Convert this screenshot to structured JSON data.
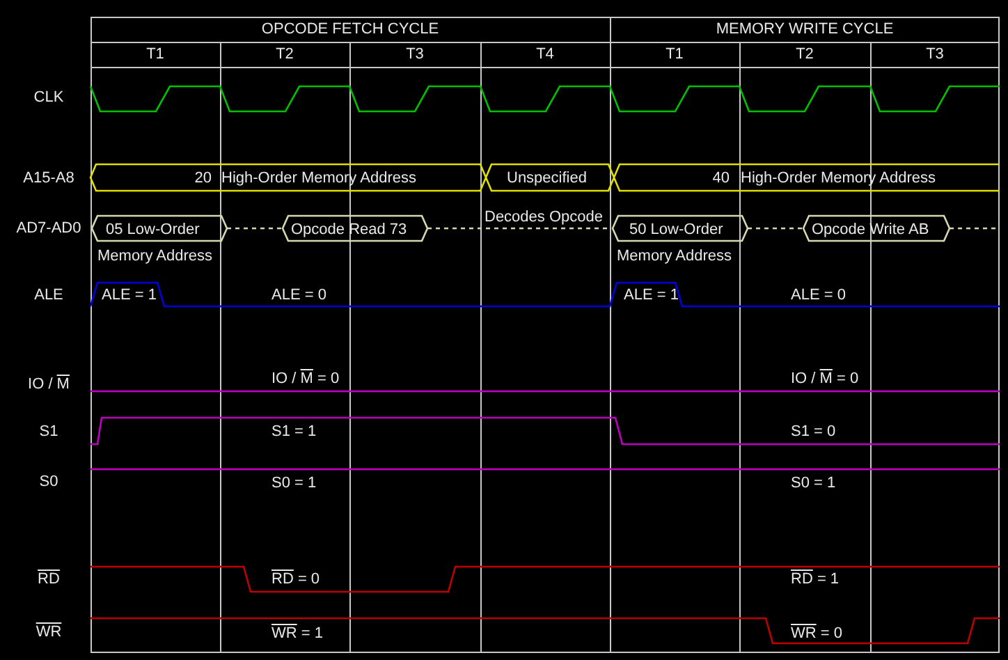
{
  "cycles": [
    {
      "title": "OPCODE FETCH CYCLE",
      "states": [
        "T1",
        "T2",
        "T3",
        "T4"
      ]
    },
    {
      "title": "MEMORY WRITE CYCLE",
      "states": [
        "T1",
        "T2",
        "T3"
      ]
    }
  ],
  "signals": [
    {
      "kind": "clock",
      "color": "#00c000",
      "name": [
        {
          "text": "CLK",
          "overline": false
        }
      ]
    },
    {
      "kind": "bus",
      "color": "#e0e000",
      "name": [
        {
          "text": "A15-A8",
          "overline": false
        }
      ],
      "annotations": [
        [
          {
            "text": "20",
            "overline": false
          }
        ],
        [
          {
            "text": "High-Order Memory Address",
            "overline": false
          }
        ],
        [
          {
            "text": "Unspecified",
            "overline": false
          }
        ],
        [
          {
            "text": "40",
            "overline": false
          }
        ],
        [
          {
            "text": "High-Order Memory Address",
            "overline": false
          }
        ]
      ]
    },
    {
      "kind": "bus",
      "color": "#d8d8b0",
      "name": [
        {
          "text": "AD7-AD0",
          "overline": false
        }
      ],
      "annotations": [
        [
          {
            "text": "05 Low-Order",
            "overline": false
          }
        ],
        [
          {
            "text": "Memory Address",
            "overline": false
          }
        ],
        [
          {
            "text": "Opcode Read 73",
            "overline": false
          }
        ],
        [
          {
            "text": "Decodes Opcode",
            "overline": false
          }
        ],
        [
          {
            "text": "50 Low-Order",
            "overline": false
          }
        ],
        [
          {
            "text": "Memory Address",
            "overline": false
          }
        ],
        [
          {
            "text": "Opcode Write AB",
            "overline": false
          }
        ]
      ]
    },
    {
      "kind": "line",
      "color": "#0000e0",
      "name": [
        {
          "text": "ALE",
          "overline": false
        }
      ],
      "annotations": [
        [
          {
            "text": "ALE = 1",
            "overline": false
          }
        ],
        [
          {
            "text": "ALE = 0",
            "overline": false
          }
        ],
        [
          {
            "text": "ALE = 1",
            "overline": false
          }
        ],
        [
          {
            "text": "ALE = 0",
            "overline": false
          }
        ]
      ]
    },
    {
      "kind": "line",
      "color": "#c000c0",
      "name": [
        {
          "text": "IO / ",
          "overline": false
        },
        {
          "text": "M",
          "overline": true
        }
      ],
      "annotations": [
        [
          {
            "text": "IO / ",
            "overline": false
          },
          {
            "text": "M",
            "overline": true
          },
          {
            "text": " = 0",
            "overline": false
          }
        ],
        [
          {
            "text": "IO / ",
            "overline": false
          },
          {
            "text": "M",
            "overline": true
          },
          {
            "text": " = 0",
            "overline": false
          }
        ]
      ]
    },
    {
      "kind": "line",
      "color": "#c000c0",
      "name": [
        {
          "text": "S1",
          "overline": false
        }
      ],
      "annotations": [
        [
          {
            "text": "S1 = 1",
            "overline": false
          }
        ],
        [
          {
            "text": "S1 = 0",
            "overline": false
          }
        ]
      ]
    },
    {
      "kind": "line",
      "color": "#c000c0",
      "name": [
        {
          "text": "S0",
          "overline": false
        }
      ],
      "annotations": [
        [
          {
            "text": "S0 = 1",
            "overline": false
          }
        ],
        [
          {
            "text": "S0 = 1",
            "overline": false
          }
        ]
      ]
    },
    {
      "kind": "line",
      "color": "#c00000",
      "name": [
        {
          "text": "RD",
          "overline": true
        }
      ],
      "annotations": [
        [
          {
            "text": "RD",
            "overline": true
          },
          {
            "text": " = 0",
            "overline": false
          }
        ],
        [
          {
            "text": "RD",
            "overline": true
          },
          {
            "text": " = 1",
            "overline": false
          }
        ]
      ]
    },
    {
      "kind": "line",
      "color": "#c00000",
      "name": [
        {
          "text": "WR",
          "overline": true
        }
      ],
      "annotations": [
        [
          {
            "text": "WR",
            "overline": true
          },
          {
            "text": " = 1",
            "overline": false
          }
        ],
        [
          {
            "text": "WR",
            "overline": true
          },
          {
            "text": " = 0",
            "overline": false
          }
        ]
      ]
    }
  ]
}
